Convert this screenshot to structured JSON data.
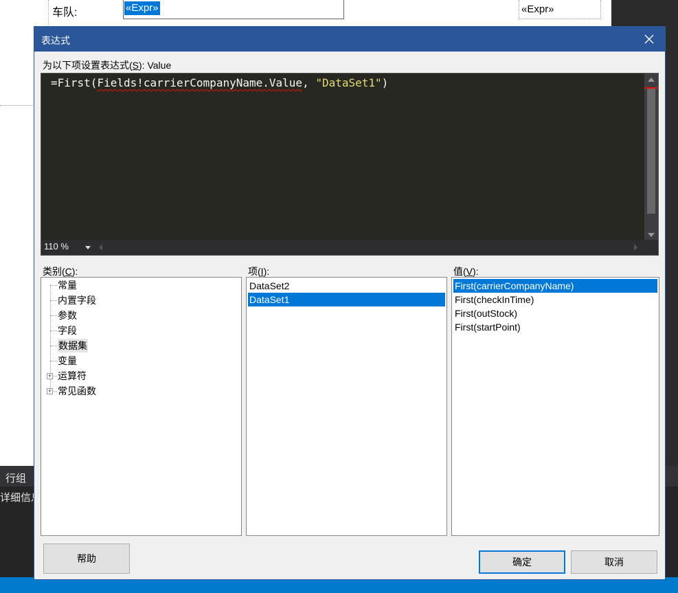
{
  "background": {
    "team_label": "车队:",
    "expr_selected": "«Expr»",
    "expr_right": "«Expr»",
    "row_group_label": "行组",
    "detail_label": "详细信息"
  },
  "dialog": {
    "title": "表达式",
    "prompt_prefix": "为以下项设置表达式(",
    "prompt_hotkey": "S",
    "prompt_suffix": "): Value",
    "editor": {
      "code_prefix": "=First(",
      "code_squiggle": "Fields!carrierCompanyName.Value",
      "code_sep": ", ",
      "code_string": "\"DataSet1\"",
      "code_suffix": ")",
      "zoom": "110 %"
    },
    "category": {
      "label_prefix": "类别(",
      "hotkey": "C",
      "label_suffix": "):",
      "items": [
        "常量",
        "内置字段",
        "参数",
        "字段",
        "数据集",
        "变量",
        "运算符",
        "常见函数"
      ],
      "selected_index": 4
    },
    "items_panel": {
      "label_prefix": "项(",
      "hotkey": "I",
      "label_suffix": "):",
      "items": [
        "DataSet2",
        "DataSet1"
      ],
      "selected_index": 1
    },
    "values_panel": {
      "label_prefix": "值(",
      "hotkey": "V",
      "label_suffix": "):",
      "items": [
        "First(carrierCompanyName)",
        "First(checkInTime)",
        "First(outStock)",
        "First(startPoint)"
      ],
      "selected_index": 0
    },
    "buttons": {
      "help": "帮助",
      "ok": "确定",
      "cancel": "取消"
    }
  },
  "colors": {
    "titlebar": "#2b579a",
    "selection": "#0078d7",
    "editor_bg": "#272822",
    "string": "#e6db74",
    "status_bar": "#007acc"
  }
}
